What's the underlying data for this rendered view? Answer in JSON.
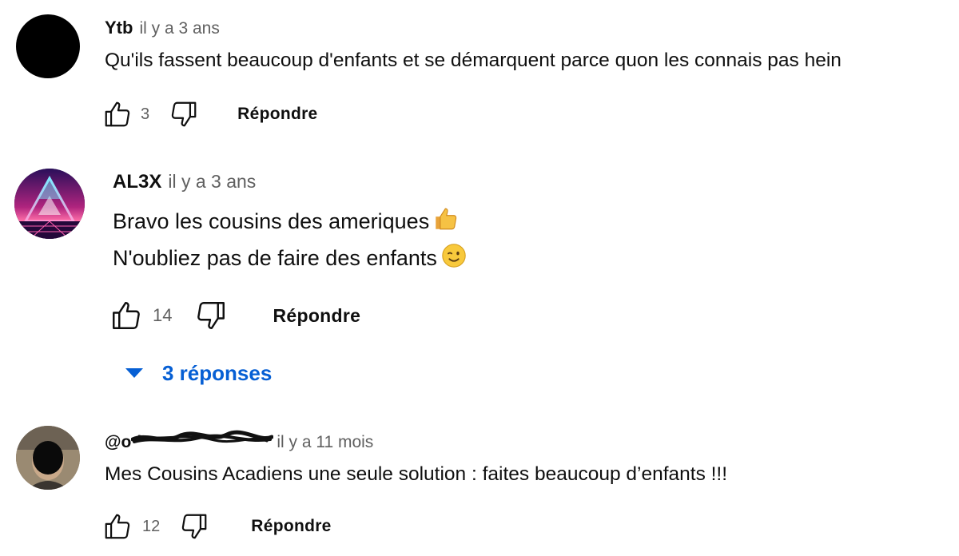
{
  "comments": [
    {
      "author": "Ytb",
      "time": "il y a 3 ans",
      "lines": [
        "Qu'ils fassent beaucoup d'enfants et se démarquent parce quon les connais pas hein"
      ],
      "likes": "3",
      "reply_label": "Répondre",
      "avatar_color": "#000000"
    },
    {
      "author": "AL3X",
      "time": "il y a 3 ans",
      "lines": [
        "Bravo les cousins des ameriques",
        "N'oubliez pas de faire des enfants"
      ],
      "line_emojis": [
        "thumbs-up-emoji",
        "winking-face-emoji"
      ],
      "likes": "14",
      "reply_label": "Répondre",
      "replies_label": "3 réponses"
    },
    {
      "author": "@o",
      "time": "il y a 11 mois",
      "lines": [
        "Mes Cousins Acadiens une seule solution : faites beaucoup d’enfants !!!"
      ],
      "likes": "12",
      "reply_label": "Répondre"
    }
  ],
  "colors": {
    "text": "#0f0f0f",
    "secondary": "#606060",
    "link": "#065fd4"
  },
  "icons": [
    "like-icon",
    "dislike-icon",
    "caret-down-icon"
  ]
}
